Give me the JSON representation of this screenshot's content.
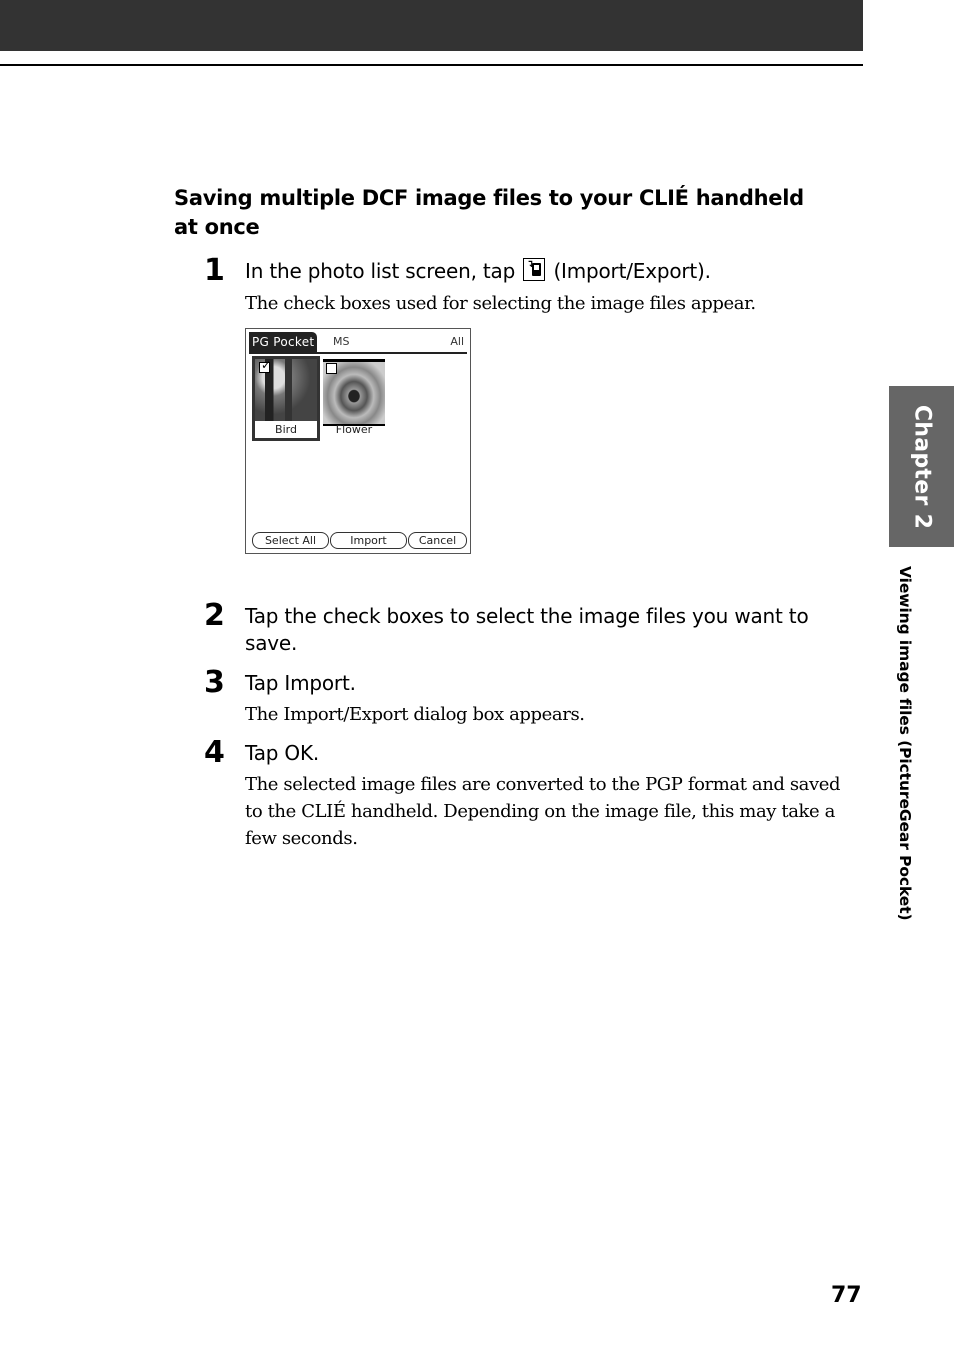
{
  "header": {
    "bar_color": "#333333"
  },
  "section": {
    "title": "Saving multiple DCF image files to your CLIÉ handheld at once"
  },
  "steps": [
    {
      "number": "1",
      "text_before_icon": "In the photo list screen, tap",
      "icon": "import-export-icon",
      "text_after_icon": "(Import/Export).",
      "description": "The check boxes used for selecting the image files appear."
    },
    {
      "number": "2",
      "text": "Tap the check boxes to select the image files you want to save."
    },
    {
      "number": "3",
      "text": "Tap Import.",
      "description": "The Import/Export dialog box appears."
    },
    {
      "number": "4",
      "text": "Tap OK.",
      "description": "The selected image files are converted to the PGP format and saved to the CLIÉ handheld. Depending on the image file, this may take a few seconds."
    }
  ],
  "device_screen": {
    "app_title": "PG Pocket",
    "category": "MS",
    "filter": "All",
    "thumbnails": [
      {
        "label": "Bird",
        "checked": true,
        "selected": true
      },
      {
        "label": "Flower",
        "checked": false,
        "selected": false
      }
    ],
    "buttons": [
      "Select All",
      "Import",
      "Cancel"
    ]
  },
  "sidebar": {
    "chapter_label": "Chapter 2",
    "chapter_tab_color": "#666666",
    "section_label": "Viewing image files  (PictureGear Pocket)"
  },
  "footer": {
    "page_number": "77"
  }
}
